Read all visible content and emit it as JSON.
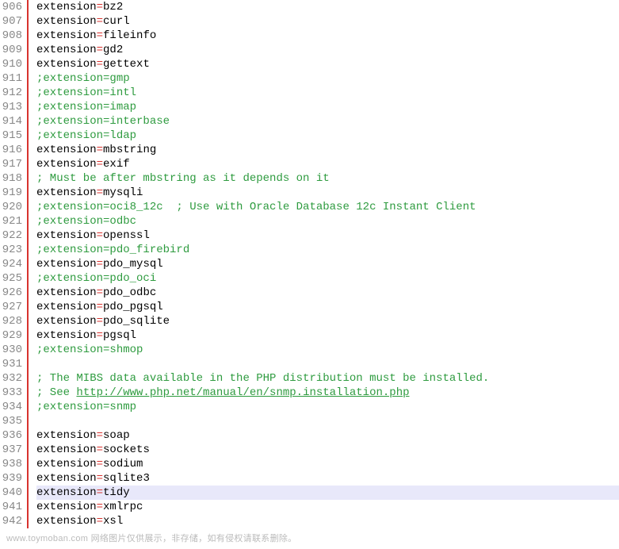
{
  "startLine": 906,
  "highlightedLine": 940,
  "lines": [
    {
      "type": "ext",
      "key": "extension",
      "val": "bz2"
    },
    {
      "type": "ext",
      "key": "extension",
      "val": "curl"
    },
    {
      "type": "ext",
      "key": "extension",
      "val": "fileinfo"
    },
    {
      "type": "ext",
      "key": "extension",
      "val": "gd2"
    },
    {
      "type": "ext",
      "key": "extension",
      "val": "gettext"
    },
    {
      "type": "comment",
      "text": ";extension=gmp"
    },
    {
      "type": "comment",
      "text": ";extension=intl"
    },
    {
      "type": "comment",
      "text": ";extension=imap"
    },
    {
      "type": "comment",
      "text": ";extension=interbase"
    },
    {
      "type": "comment",
      "text": ";extension=ldap"
    },
    {
      "type": "ext",
      "key": "extension",
      "val": "mbstring"
    },
    {
      "type": "ext",
      "key": "extension",
      "val": "exif"
    },
    {
      "type": "comment",
      "text": "; Must be after mbstring as it depends on it"
    },
    {
      "type": "ext",
      "key": "extension",
      "val": "mysqli"
    },
    {
      "type": "comment",
      "text": ";extension=oci8_12c  ; Use with Oracle Database 12c Instant Client"
    },
    {
      "type": "comment",
      "text": ";extension=odbc"
    },
    {
      "type": "ext",
      "key": "extension",
      "val": "openssl"
    },
    {
      "type": "comment",
      "text": ";extension=pdo_firebird"
    },
    {
      "type": "ext",
      "key": "extension",
      "val": "pdo_mysql"
    },
    {
      "type": "comment",
      "text": ";extension=pdo_oci"
    },
    {
      "type": "ext",
      "key": "extension",
      "val": "pdo_odbc"
    },
    {
      "type": "ext",
      "key": "extension",
      "val": "pdo_pgsql"
    },
    {
      "type": "ext",
      "key": "extension",
      "val": "pdo_sqlite"
    },
    {
      "type": "ext",
      "key": "extension",
      "val": "pgsql"
    },
    {
      "type": "comment",
      "text": ";extension=shmop"
    },
    {
      "type": "blank"
    },
    {
      "type": "comment",
      "text": "; The MIBS data available in the PHP distribution must be installed."
    },
    {
      "type": "comment-link",
      "prefix": "; See ",
      "link": "http://www.php.net/manual/en/snmp.installation.php"
    },
    {
      "type": "comment",
      "text": ";extension=snmp"
    },
    {
      "type": "blank"
    },
    {
      "type": "ext",
      "key": "extension",
      "val": "soap"
    },
    {
      "type": "ext",
      "key": "extension",
      "val": "sockets"
    },
    {
      "type": "ext",
      "key": "extension",
      "val": "sodium"
    },
    {
      "type": "ext",
      "key": "extension",
      "val": "sqlite3"
    },
    {
      "type": "ext",
      "key": "extension",
      "val": "tidy"
    },
    {
      "type": "ext",
      "key": "extension",
      "val": "xmlrpc"
    },
    {
      "type": "ext",
      "key": "extension",
      "val": "xsl"
    }
  ],
  "watermark": "www.toymoban.com 网络图片仅供展示，非存储，如有侵权请联系删除。"
}
